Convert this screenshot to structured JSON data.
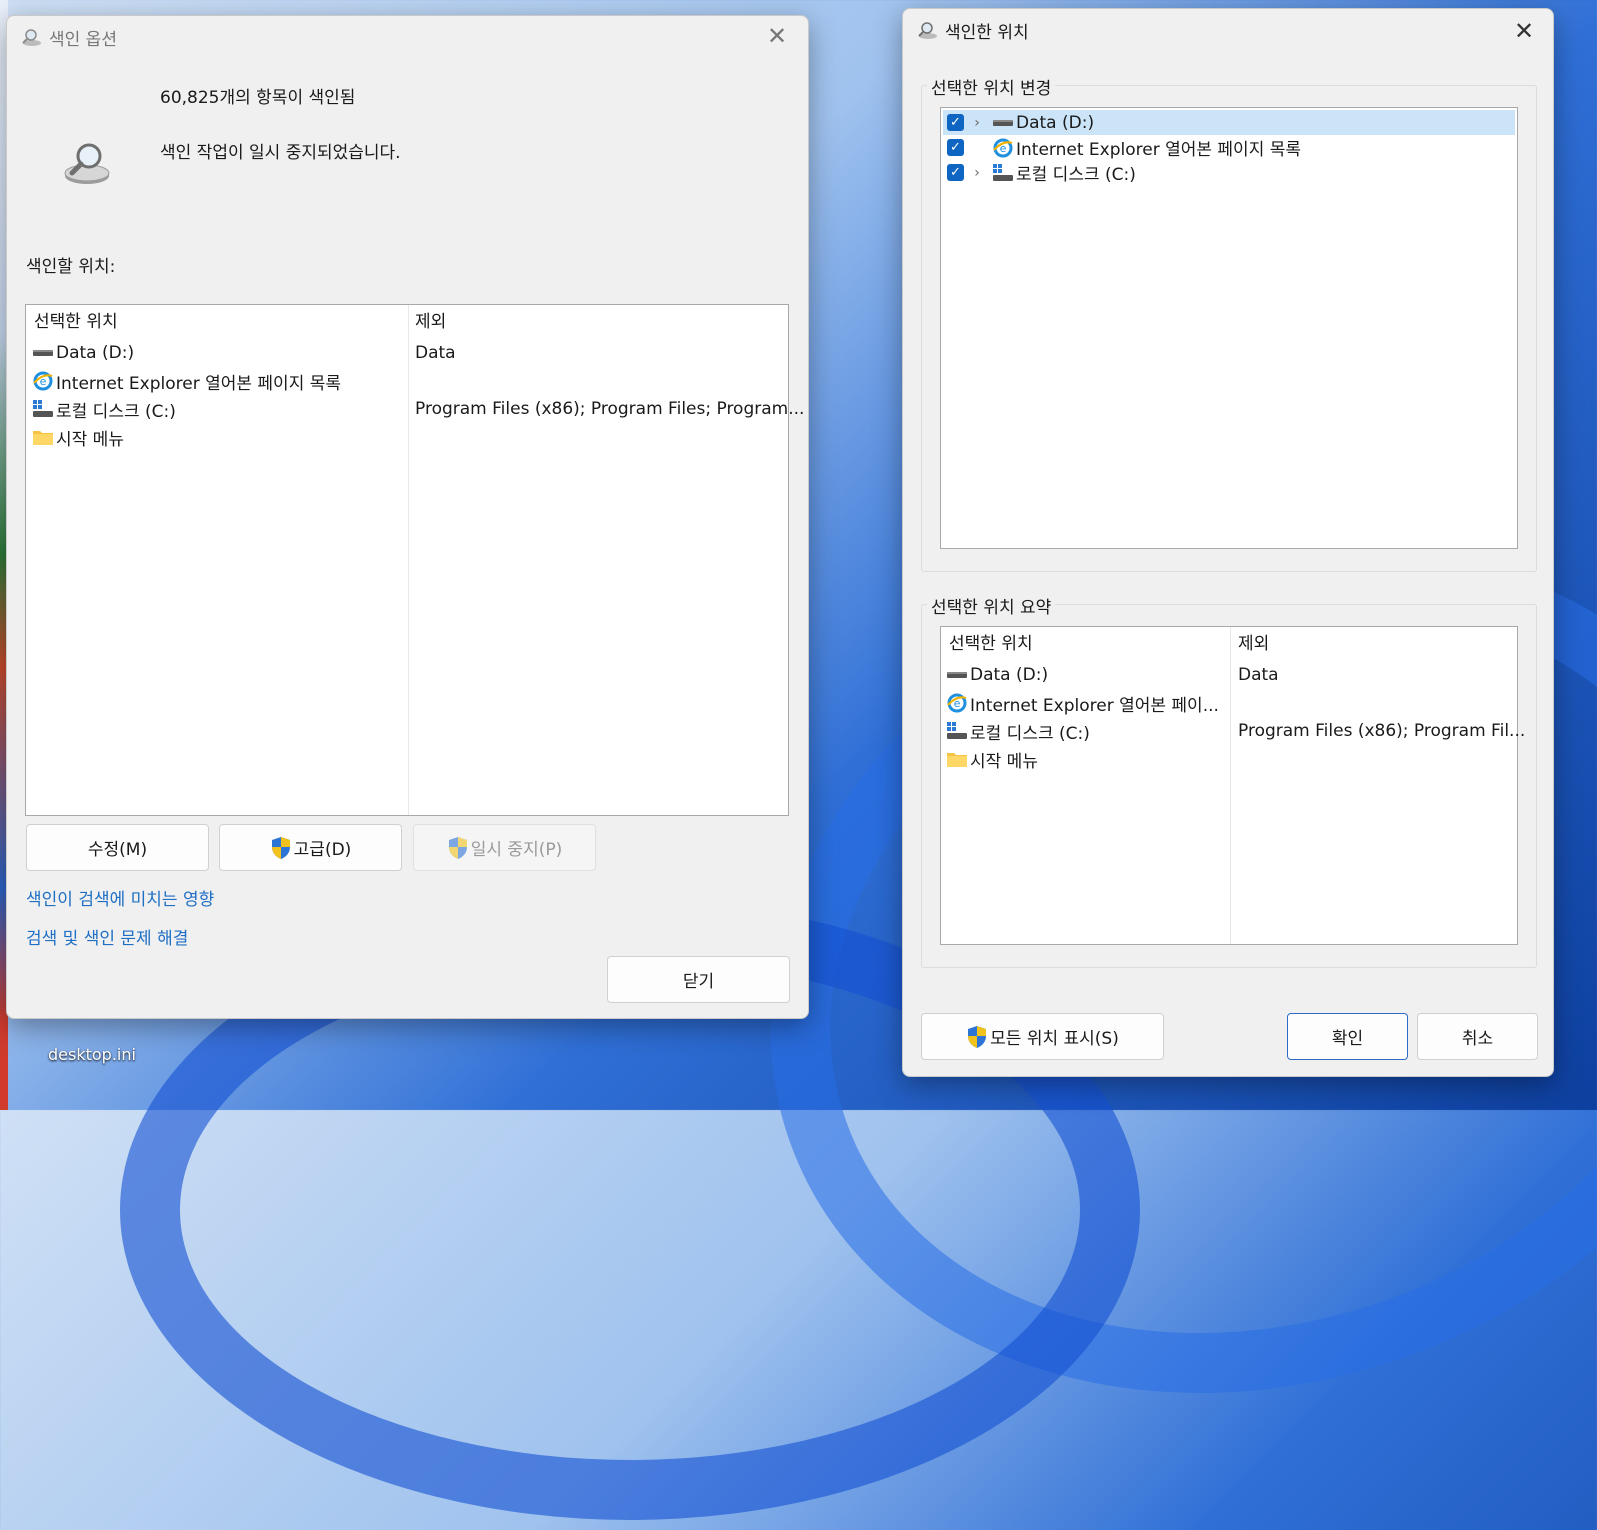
{
  "desktop": {
    "icon_label": "desktop.ini"
  },
  "index_options": {
    "title": "색인 옵션",
    "close_glyph": "✕",
    "item_count": "60,825개의 항목이 색인됨",
    "status": "색인 작업이 일시 중지되었습니다.",
    "locations_label": "색인할 위치:",
    "columns": [
      "선택한 위치",
      "제외"
    ],
    "rows": [
      {
        "icon": "drive-icon",
        "location": "Data (D:)",
        "exclude": "Data"
      },
      {
        "icon": "internet-explorer-icon",
        "location": "Internet Explorer 열어본 페이지 목록",
        "exclude": ""
      },
      {
        "icon": "windows-drive-icon",
        "location": "로컬 디스크 (C:)",
        "exclude": "Program Files (x86); Program Files; Program..."
      },
      {
        "icon": "folder-icon",
        "location": "시작 메뉴",
        "exclude": ""
      }
    ],
    "buttons": {
      "modify": "수정(M)",
      "advanced": "고급(D)",
      "pause": "일시 중지(P)",
      "close": "닫기"
    },
    "links": {
      "effect": "색인이 검색에 미치는 영향",
      "troubleshoot": "검색 및 색인 문제 해결"
    }
  },
  "indexed_locations": {
    "title": "색인한 위치",
    "close_glyph": "✕",
    "change_group_title": "선택한 위치 변경",
    "tree": [
      {
        "icon": "drive-icon",
        "label": "Data (D:)",
        "checked": true,
        "expandable": true,
        "selected": true
      },
      {
        "icon": "internet-explorer-icon",
        "label": "Internet Explorer 열어본 페이지 목록",
        "checked": true,
        "expandable": false,
        "selected": false
      },
      {
        "icon": "windows-drive-icon",
        "label": "로컬 디스크 (C:)",
        "checked": true,
        "expandable": true,
        "selected": false
      }
    ],
    "summary_group_title": "선택한 위치 요약",
    "summary_columns": [
      "선택한 위치",
      "제외"
    ],
    "summary_rows": [
      {
        "icon": "drive-icon",
        "location": "Data (D:)",
        "exclude": "Data"
      },
      {
        "icon": "internet-explorer-icon",
        "location": "Internet Explorer 열어본 페이...",
        "exclude": ""
      },
      {
        "icon": "windows-drive-icon",
        "location": "로컬 디스크 (C:)",
        "exclude": "Program Files (x86); Program Fil..."
      },
      {
        "icon": "folder-icon",
        "location": "시작 메뉴",
        "exclude": ""
      }
    ],
    "buttons": {
      "show_all": "모든 위치 표시(S)",
      "ok": "확인",
      "cancel": "취소"
    }
  }
}
